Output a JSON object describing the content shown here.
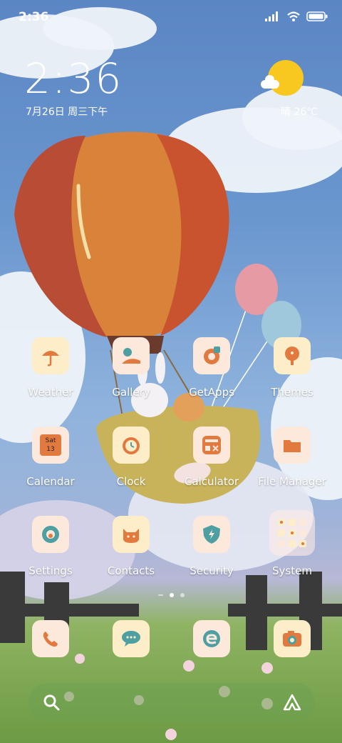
{
  "status": {
    "time": "2:36"
  },
  "clock_widget": {
    "time": "2:36",
    "date": "7月26日 周三下午"
  },
  "weather_widget": {
    "text": "晴 26℃",
    "icon": "sunny-cloud-icon"
  },
  "apps": [
    {
      "label": "Weather",
      "icon": "weather-icon"
    },
    {
      "label": "Gallery",
      "icon": "gallery-icon"
    },
    {
      "label": "GetApps",
      "icon": "getapps-icon"
    },
    {
      "label": "Themes",
      "icon": "themes-icon"
    },
    {
      "label": "Calendar",
      "icon": "calendar-icon",
      "badge_day": "Sat",
      "badge_date": "13"
    },
    {
      "label": "Clock",
      "icon": "clock-icon"
    },
    {
      "label": "Calculator",
      "icon": "calculator-icon"
    },
    {
      "label": "File Manager",
      "icon": "file-manager-icon"
    },
    {
      "label": "Settings",
      "icon": "settings-icon"
    },
    {
      "label": "Contacts",
      "icon": "contacts-icon"
    },
    {
      "label": "Security",
      "icon": "security-icon"
    },
    {
      "label": "System",
      "icon": "system-folder-icon"
    }
  ],
  "dock": [
    {
      "icon": "phone-icon"
    },
    {
      "icon": "messages-icon"
    },
    {
      "icon": "browser-icon"
    },
    {
      "icon": "camera-icon"
    }
  ],
  "page_indicator": {
    "pages": 2,
    "active": 1
  },
  "colors": {
    "icon_bg_pink": "#fde8dc",
    "icon_bg_yellow": "#fdedc8",
    "accent_orange": "#e27a3f",
    "accent_teal": "#4d9fa2"
  }
}
